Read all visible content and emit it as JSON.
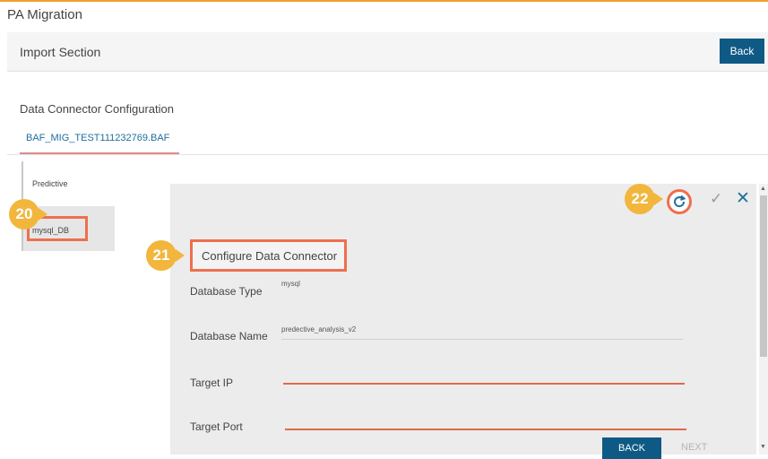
{
  "app": {
    "title": "PA Migration"
  },
  "import_section": {
    "title": "Import Section",
    "back_label": "Back"
  },
  "data_connector": {
    "title": "Data Connector Configuration",
    "file_tab": "BAF_MIG_TEST111232769.BAF"
  },
  "sidebar": {
    "items": [
      {
        "label": "Predictive"
      },
      {
        "label": "mysql_DB"
      }
    ]
  },
  "callouts": {
    "c20": "20",
    "c21": "21",
    "c22": "22"
  },
  "config": {
    "heading": "Configure Data Connector",
    "fields": [
      {
        "label": "Database Type",
        "value": "mysql"
      },
      {
        "label": "Database Name",
        "value": "predective_analysis_v2"
      },
      {
        "label": "Target IP",
        "value": ""
      },
      {
        "label": "Target Port",
        "value": ""
      }
    ],
    "back_label": "BACK",
    "next_label": "NEXT"
  },
  "colors": {
    "accent": "#0f5a85",
    "callout": "#f2b63d",
    "highlight": "#ee6f4e"
  },
  "icons": [
    "refresh-icon",
    "check-icon",
    "close-icon"
  ]
}
